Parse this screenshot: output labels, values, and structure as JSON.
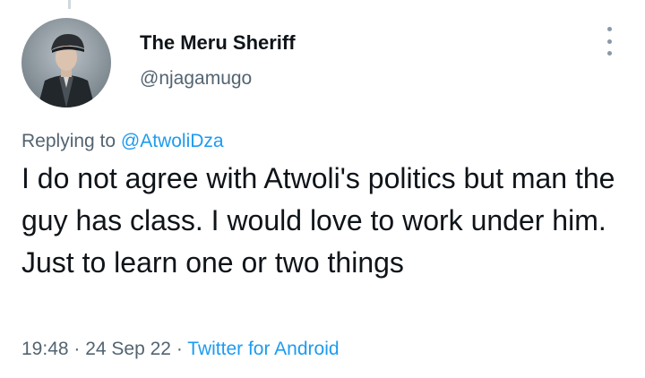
{
  "author": {
    "display_name": "The Meru Sheriff",
    "handle": "@njagamugo",
    "avatar_icon": "profile-photo"
  },
  "more_icon": "vertical-ellipsis-icon",
  "reply": {
    "prefix": "Replying to",
    "target": "@AtwoliDza"
  },
  "tweet": {
    "text": "I do not agree with Atwoli's politics but man the guy has class. I would love to work under him. Just to learn one or two things"
  },
  "meta": {
    "time": "19:48",
    "sep1": " · ",
    "date": "24 Sep 22",
    "sep2": " · ",
    "source": "Twitter for Android"
  },
  "colors": {
    "link": "#1d9bf0",
    "secondary_text": "#536471",
    "primary_text": "#0f1419"
  }
}
